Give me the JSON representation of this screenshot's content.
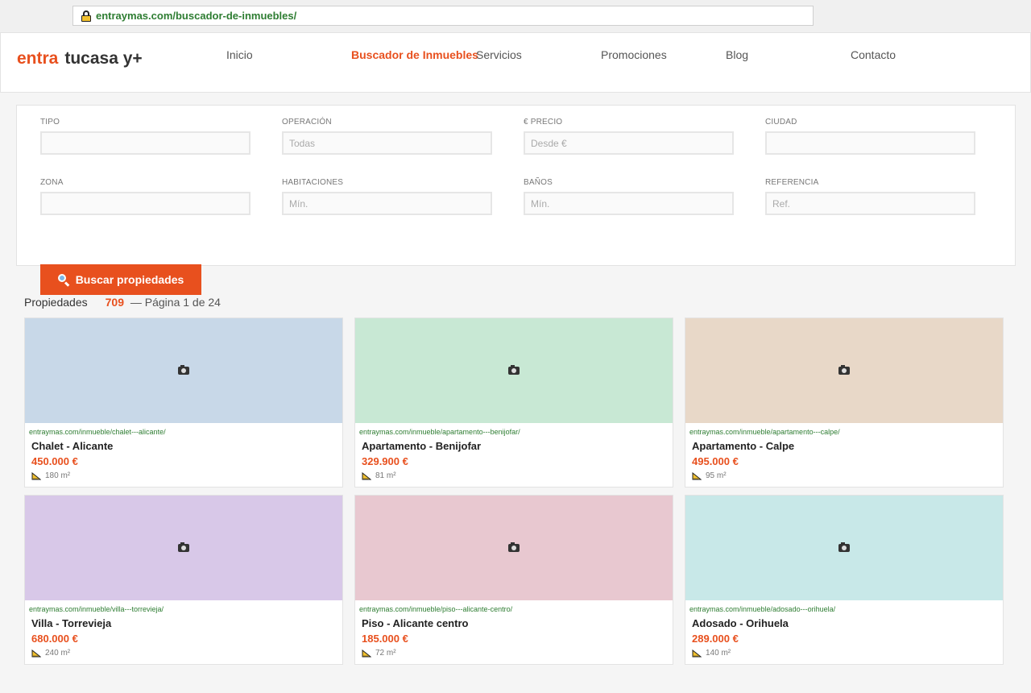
{
  "browser": {
    "url": "entraymas.com/buscador-de-inmuebles/"
  },
  "brand": {
    "part1": "entra",
    "part2": "tucasa y+",
    "accent_color": "#e8501e"
  },
  "nav": [
    {
      "label": "Inicio"
    },
    {
      "label": "Buscador de Inmuebles",
      "active": true
    },
    {
      "label": "Servicios"
    },
    {
      "label": "Promociones"
    },
    {
      "label": "Blog"
    },
    {
      "label": "Contacto"
    }
  ],
  "filters": {
    "tipo": {
      "label": "TIPO",
      "placeholder": ""
    },
    "operacion": {
      "label": "OPERACIÓN",
      "placeholder": "Todas"
    },
    "precio": {
      "label": "€ PRECIO",
      "placeholder": "Desde €"
    },
    "ciudad": {
      "label": "CIUDAD",
      "placeholder": ""
    },
    "zona": {
      "label": "ZONA",
      "placeholder": ""
    },
    "habitaciones": {
      "label": "HABITACIONES",
      "placeholder": "Mín."
    },
    "banos": {
      "label": "BAÑOS",
      "placeholder": "Mín."
    },
    "referencia": {
      "label": "REFERENCIA",
      "placeholder": "Ref."
    },
    "search_button": "Buscar propiedades",
    "search_icon": "magnifier-icon"
  },
  "results": {
    "label": "Propiedades",
    "count": "709",
    "page_text": "— Página 1 de 24"
  },
  "listings": [
    {
      "url": "entraymas.com/inmueble/chalet---alicante/",
      "title": "Chalet - Alicante",
      "price": "450.000 €",
      "area": "180 m²",
      "image_color": "#c8d8e8"
    },
    {
      "url": "entraymas.com/inmueble/apartamento---benijofar/",
      "title": "Apartamento - Benijofar",
      "price": "329.900 €",
      "area": "81 m²",
      "image_color": "#c8e8d4"
    },
    {
      "url": "entraymas.com/inmueble/apartamento---calpe/",
      "title": "Apartamento - Calpe",
      "price": "495.000 €",
      "area": "95 m²",
      "image_color": "#e8d8c8"
    },
    {
      "url": "entraymas.com/inmueble/villa---torrevieja/",
      "title": "Villa - Torrevieja",
      "price": "680.000 €",
      "area": "240 m²",
      "image_color": "#d8c8e8"
    },
    {
      "url": "entraymas.com/inmueble/piso---alicante-centro/",
      "title": "Piso - Alicante centro",
      "price": "185.000 €",
      "area": "72 m²",
      "image_color": "#e8c8d0"
    },
    {
      "url": "entraymas.com/inmueble/adosado---orihuela/",
      "title": "Adosado - Orihuela",
      "price": "289.000 €",
      "area": "140 m²",
      "image_color": "#c8e8e8"
    }
  ]
}
